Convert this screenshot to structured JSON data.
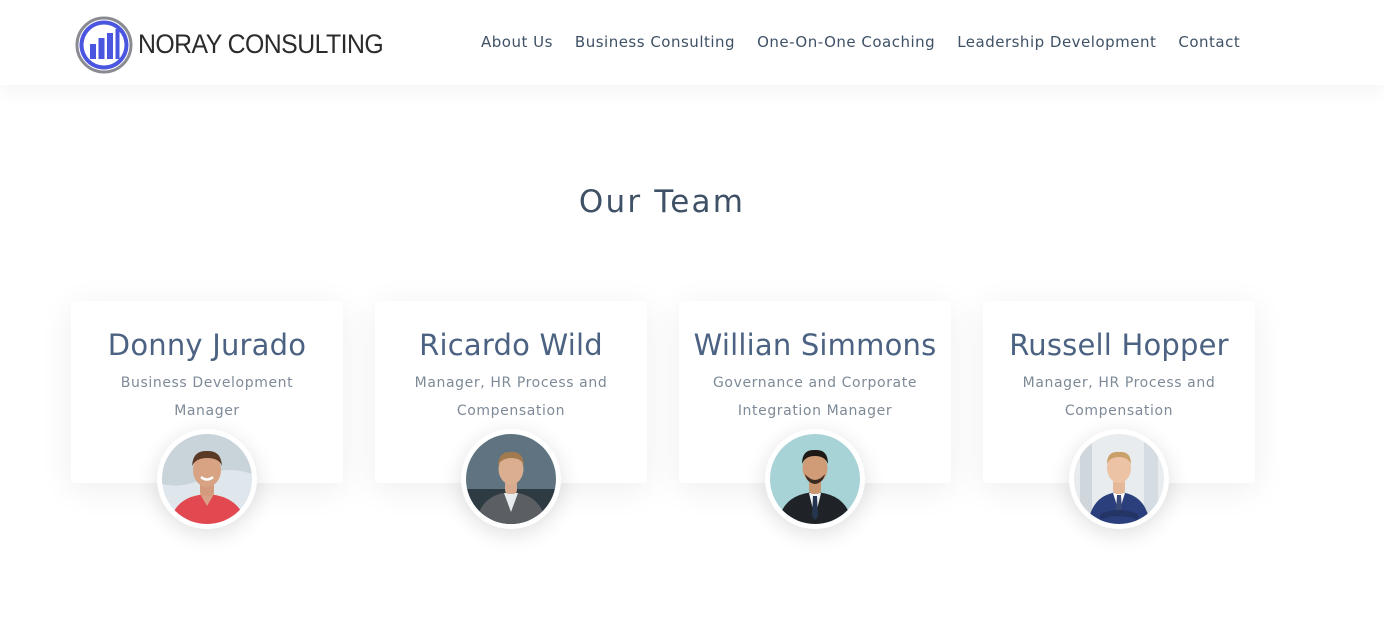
{
  "header": {
    "logo_text": "NORAY CONSULTING",
    "nav": [
      {
        "label": "About Us"
      },
      {
        "label": "Business Consulting"
      },
      {
        "label": "One-On-One Coaching"
      },
      {
        "label": "Leadership Development"
      },
      {
        "label": "Contact"
      }
    ]
  },
  "team": {
    "title": "Our Team",
    "members": [
      {
        "name": "Donny Jurado",
        "role": "Business Development Manager"
      },
      {
        "name": "Ricardo Wild",
        "role": "Manager, HR Process and Compensation"
      },
      {
        "name": "Willian Simmons",
        "role": "Governance and Corporate Integration Manager"
      },
      {
        "name": "Russell Hopper",
        "role": "Manager, HR Process and Compensation"
      }
    ]
  },
  "colors": {
    "accent": "#4a55e0",
    "text": "#3f5166",
    "name": "#4b6282",
    "muted": "#7e8a97"
  }
}
